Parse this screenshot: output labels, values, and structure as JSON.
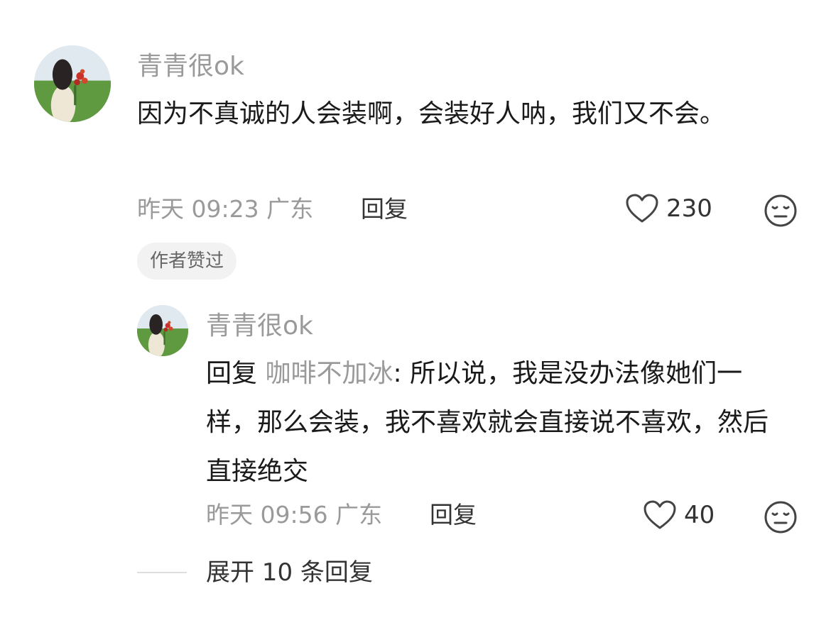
{
  "comment": {
    "author": "青青很ok",
    "text": "因为不真诚的人会装啊，会装好人呐，我们又不会。",
    "time": "昨天 09:23 广东",
    "reply_label": "回复",
    "like_count": "230",
    "author_liked_badge": "作者赞过",
    "avatar_icon": "avatar-photo"
  },
  "reply": {
    "author": "青青很ok",
    "prefix": "回复",
    "reply_to": "咖啡不加冰",
    "separator": ": ",
    "text": "所以说，我是没办法像她们一样，那么会装，我不喜欢就会直接说不喜欢，然后直接绝交",
    "time": "昨天 09:56 广东",
    "reply_label": "回复",
    "like_count": "40"
  },
  "expand": {
    "label": "展开 10 条回复"
  },
  "icons": {
    "like": "heart-outline-icon",
    "dislike": "meh-face-icon"
  },
  "colors": {
    "primary_text": "#1a1a1a",
    "secondary_text": "#9a9a9a",
    "badge_bg": "#f2f2f2"
  }
}
